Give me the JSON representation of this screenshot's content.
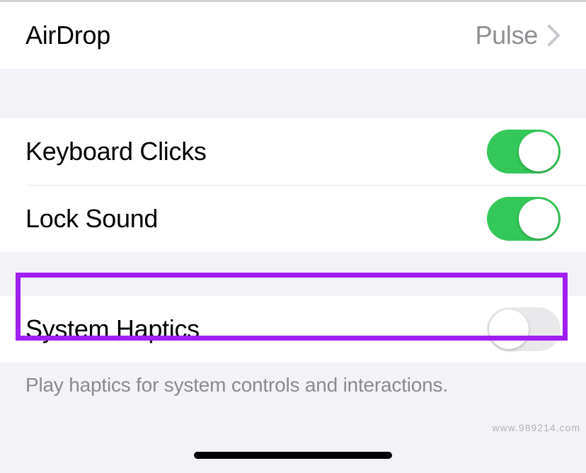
{
  "rows": {
    "airdrop": {
      "label": "AirDrop",
      "value": "Pulse"
    },
    "keyboard_clicks": {
      "label": "Keyboard Clicks",
      "on": true
    },
    "lock_sound": {
      "label": "Lock Sound",
      "on": true
    },
    "system_haptics": {
      "label": "System Haptics",
      "on": false
    }
  },
  "footer": "Play haptics for system controls and interactions.",
  "watermark": "www.989214.com"
}
